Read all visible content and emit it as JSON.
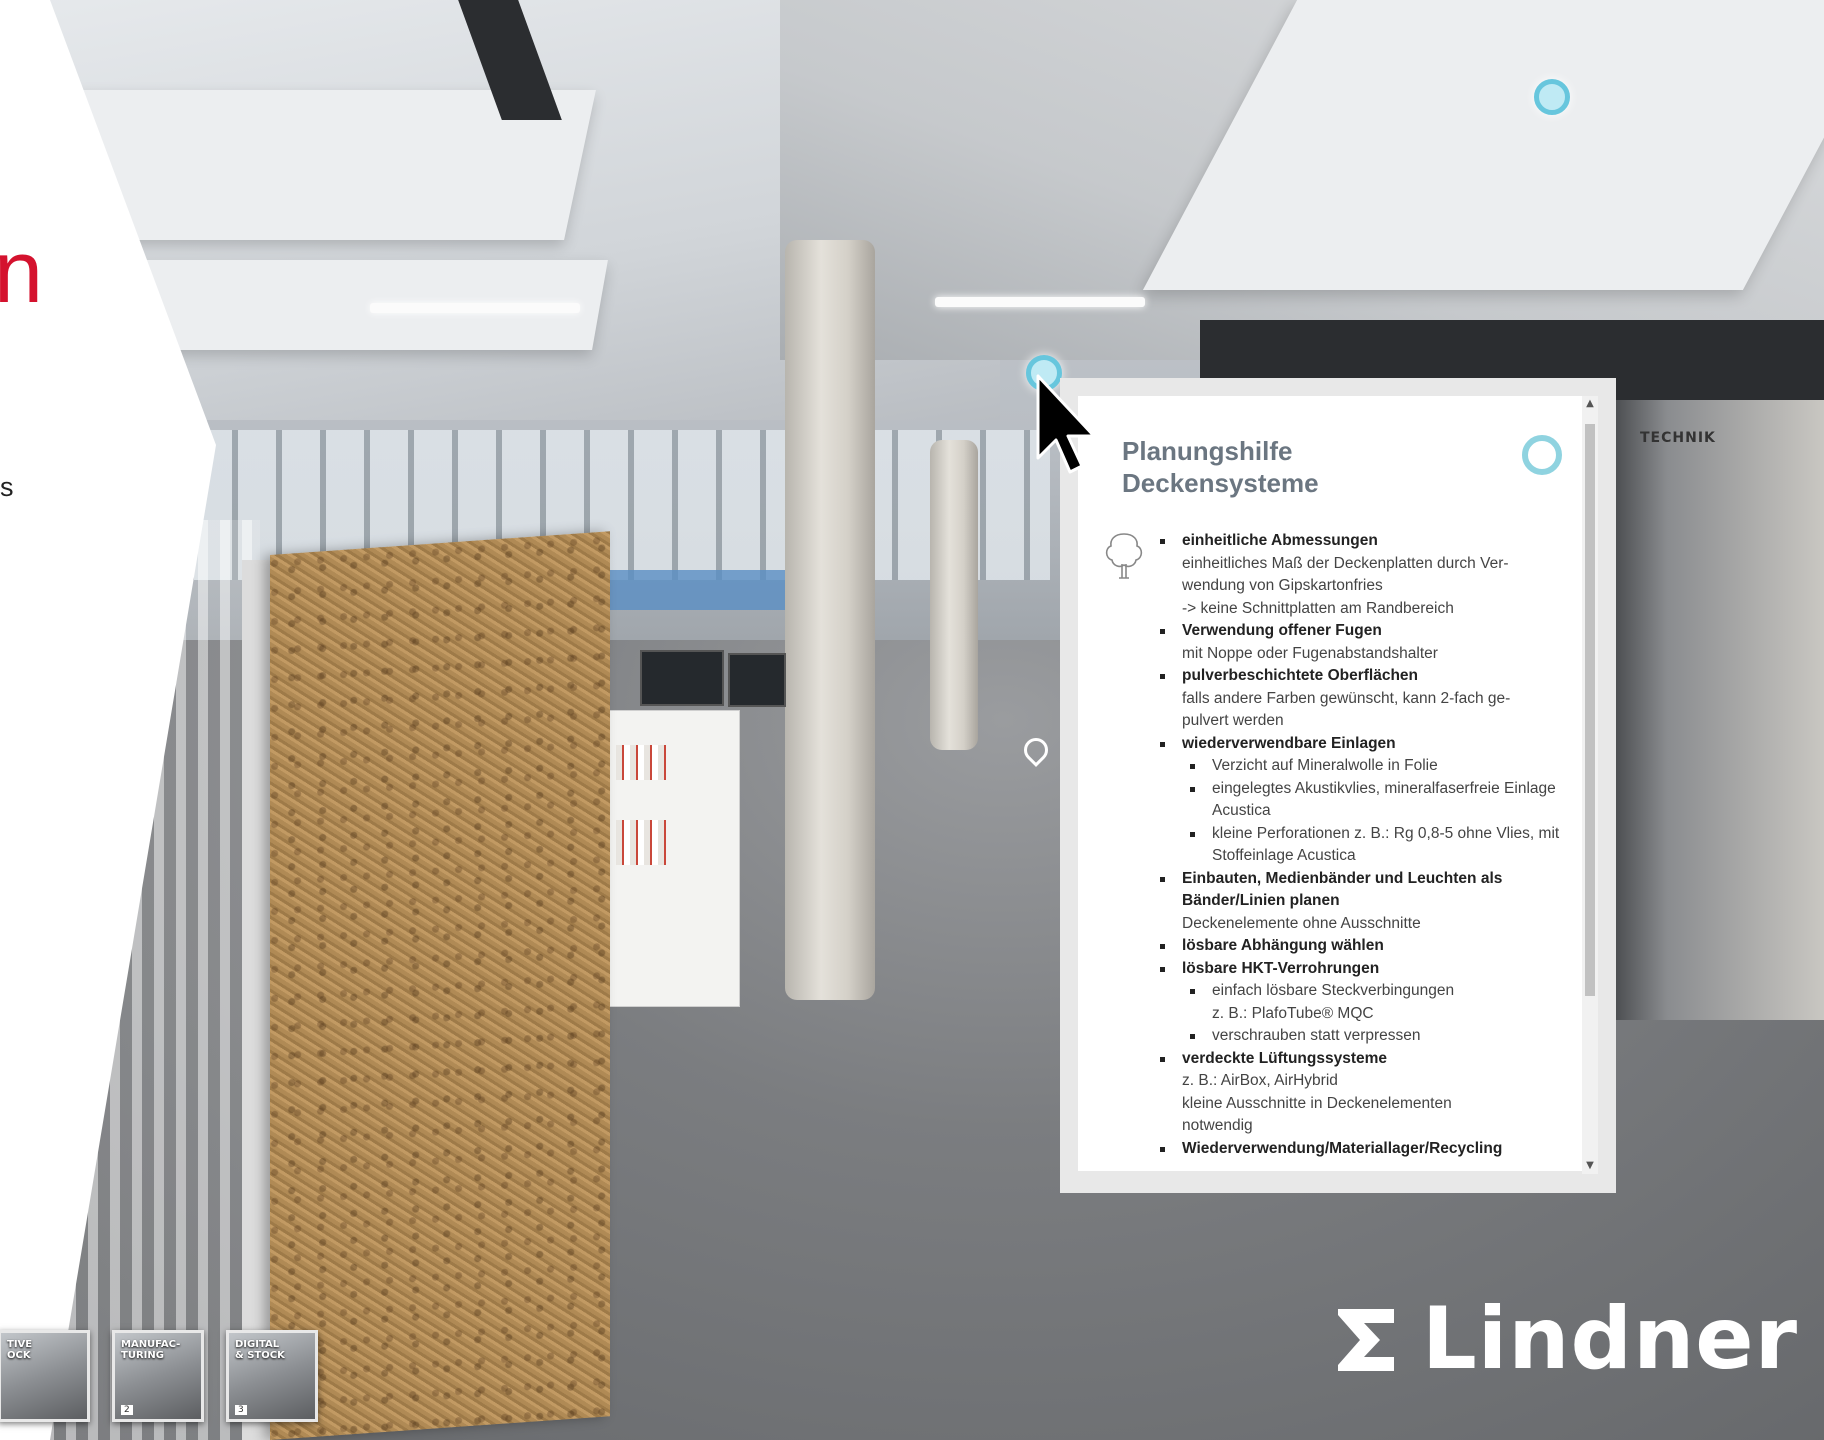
{
  "intro": {
    "heading_fragment": "n",
    "text_fragment": "s"
  },
  "tour": {
    "thumbnails": [
      {
        "label": "TIVE\nOCK",
        "number": ""
      },
      {
        "label": "MANUFAC-\nTURING",
        "number": "2"
      },
      {
        "label": "DIGITAL\n& STOCK",
        "number": "3"
      }
    ],
    "room_sign": "TECHNIK"
  },
  "popup": {
    "title_line1": "Planungshilfe",
    "title_line2": "Deckensysteme",
    "items": [
      {
        "title": "einheitliche Abmessungen",
        "desc": [
          "einheitliches Maß der Deckenplatten durch Ver-",
          "wendung von Gipskartonfries",
          "-> keine Schnittplatten am Randbereich"
        ]
      },
      {
        "title": "Verwendung offener Fugen",
        "desc": [
          "mit Noppe oder Fugenabstandshalter"
        ]
      },
      {
        "title": "pulverbeschichtete Oberflächen",
        "desc": [
          "falls andere Farben gewünscht, kann 2-fach ge-",
          "pulvert werden"
        ]
      },
      {
        "title": "wiederverwendbare Einlagen",
        "sub": [
          "Verzicht auf Mineralwolle in Folie",
          "eingelegtes Akustikvlies, mineralfaserfreie Einlage Acustica",
          "kleine Perforationen z. B.: Rg 0,8-5 ohne Vlies, mit Stoffeinlage Acustica"
        ]
      },
      {
        "title": "Einbauten, Medienbänder und Leuchten als Bänder/Linien planen",
        "desc": [
          "Deckenelemente ohne Ausschnitte"
        ]
      },
      {
        "title": "lösbare Abhängung wählen"
      },
      {
        "title": "lösbare HKT-Verrohrungen",
        "sub": [
          "einfach lösbare Steckverbingungen",
          "z. B.: PlafoTube® MQC",
          "verschrauben statt verpressen"
        ]
      },
      {
        "title": "verdeckte Lüftungssysteme",
        "desc": [
          "z. B.: AirBox, AirHybrid",
          "kleine Ausschnitte in Deckenelementen",
          "notwendig"
        ]
      },
      {
        "title": "Wiederverwendung/Materiallager/Recycling"
      }
    ]
  },
  "logo": {
    "text": "Lindner"
  },
  "colors": {
    "accent_red": "#d4122e",
    "hotspot": "#67c6dd",
    "title_gray": "#6b7681"
  },
  "icons": {
    "close": "circle-close-icon",
    "tree": "tree-icon",
    "cursor": "cursor-arrow-icon",
    "pin": "location-pin-icon"
  }
}
